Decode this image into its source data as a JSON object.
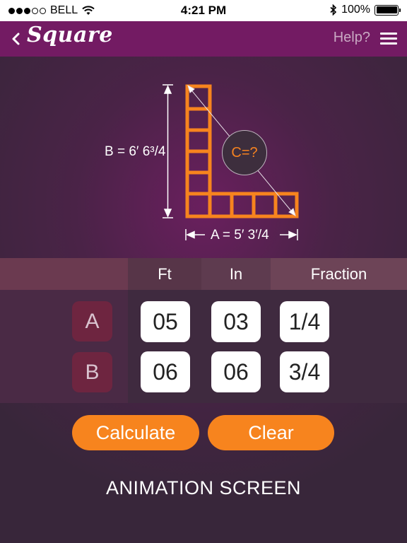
{
  "status_bar": {
    "carrier": "BELL",
    "time": "4:21 PM",
    "battery": "100%",
    "signal_bars_filled": 3,
    "signal_bars_total": 5
  },
  "nav": {
    "title": "Square",
    "help_label": "Help?"
  },
  "diagram": {
    "side_b_label": "B = 6′ 6³/4",
    "side_a_label": "A = 5′ 3′/4",
    "hypotenuse_label": "C=?"
  },
  "table": {
    "headers": [
      "Ft",
      "In",
      "Fraction"
    ],
    "rows": [
      {
        "label": "A",
        "ft": "05",
        "in": "03",
        "fraction": "1/4"
      },
      {
        "label": "B",
        "ft": "06",
        "in": "06",
        "fraction": "3/4"
      }
    ]
  },
  "buttons": {
    "calculate": "Calculate",
    "clear": "Clear"
  },
  "footer": "ANIMATION SCREEN",
  "colors": {
    "accent": "#f7841e",
    "navbar": "#731b63",
    "row_label_bg": "#6e2540"
  },
  "icons": {
    "back": "chevron-left-icon",
    "menu": "hamburger-icon",
    "wifi": "wifi-icon",
    "bluetooth": "bluetooth-icon",
    "battery": "battery-icon"
  }
}
